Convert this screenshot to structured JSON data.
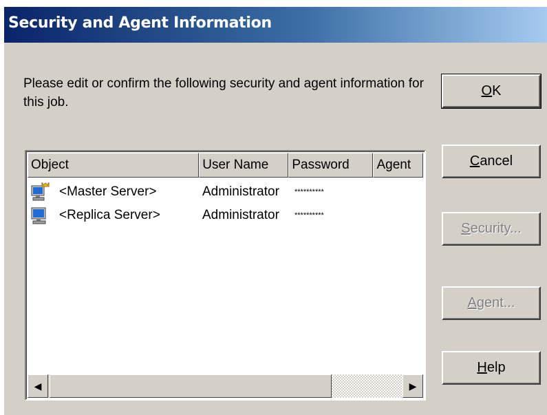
{
  "window": {
    "title": "Security and Agent Information",
    "title_gradient": [
      "#0a246a",
      "#3a6ea5",
      "#a6caf0"
    ],
    "face_color": "#d4d0c8"
  },
  "instructions": "Please edit or confirm the following security and agent information for this job.",
  "list": {
    "columns": [
      "Object",
      "User Name",
      "Password",
      "Agent"
    ],
    "rows": [
      {
        "icon": "master-server-icon",
        "object": "<Master Server>",
        "user": "Administrator",
        "password": "**********",
        "agent": ""
      },
      {
        "icon": "replica-server-icon",
        "object": "<Replica Server>",
        "user": "Administrator",
        "password": "**********",
        "agent": ""
      }
    ]
  },
  "buttons": {
    "ok": {
      "mnemonic": "O",
      "rest": "K"
    },
    "cancel": {
      "mnemonic": "C",
      "rest": "ancel"
    },
    "security": {
      "mnemonic": "S",
      "rest": "ecurity..."
    },
    "agent": {
      "mnemonic": "A",
      "rest": "gent..."
    },
    "help": {
      "mnemonic": "H",
      "rest": "elp"
    }
  },
  "scrollbar": {
    "left_arrow": "◀",
    "right_arrow": "▶"
  }
}
